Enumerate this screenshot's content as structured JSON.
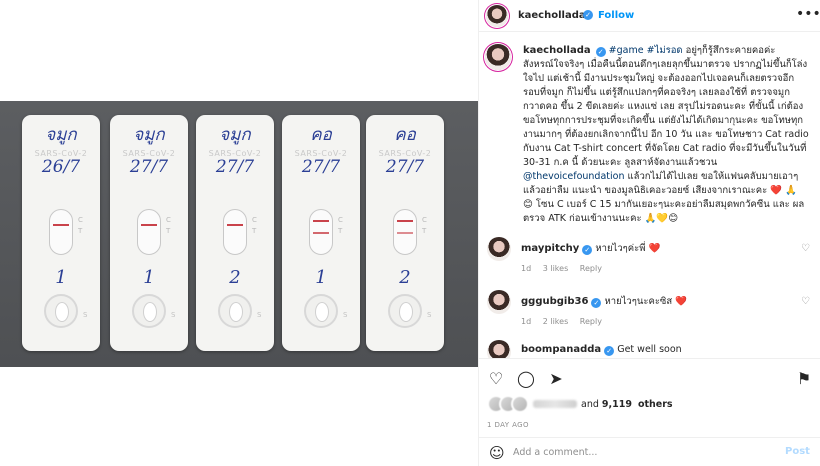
{
  "post": {
    "username": "kaechollada",
    "follow_label": "Follow",
    "more_icon": "more-horizontal-icon"
  },
  "caption": {
    "username": "kaechollada",
    "hashtags": [
      "#game",
      "#ไม่รอด"
    ],
    "text_part1": "อยู่ๆก็รู้สึกระคายคอค่ะ สังหรณ์ใจจริงๆ เมื่อคืนนี้ตอนดึกๆเลยลุกขึ้นมาตรวจ ปรากฏไม่ขึ้นก็โล่งใจไป แต่เช้านี้ มีงานประชุมใหญ่ จะต้องออกไปเจอคนก็เลยตรวจอีกรอบที่จมูก ก็ไม่ขึ้น แต่รู้สึกแปลกๆที่คอจริงๆ เลยลองใช้ที่ ตรวจจมูกกวาดคอ ขึ้น 2 ขีดเลยค่ะ แหงแซ่ เลย สรุปไม่รอดนะคะ ที่ขั้นนี้ เก่ต้องขอโทษทุกการประชุมที่จะเกิดขึ้น แต่ยังไม่ได้เกิดมากุนะคะ ขอโทษทุกงานมากๆ ที่ต้องยกเลิกจากนี้ไป อีก 10 วัน และ ขอโทษชาว Cat radio กับงาน Cat T-shirt concert ที่จัดโดย Cat radio ที่จะมีวันขึ้นในวันที่ 30-31 ก.ค นี้ ด้วยนะคะ ลูลสาห์จัดงานแล้วชวน",
    "mention": "@thevoicefoundation",
    "text_part2": "แล้วกไม่ได้ไปเลย ขอให้แฟนคลับมายเอาๆ แล้วอย่าลืม แนะนำ ของมูลนิธิเคอะวอยซ์ เสียงจากเราณะคะ ❤️ 🙏 😊 โซน C เบอร์ C 15 มากันเยอะๆนะคะอย่าลืมสมุดพกวัคซีน และ ผลตรวจ ATK ก่อนเข้างานนะคะ 🙏💛😊"
  },
  "comments": [
    {
      "username": "maypitchy",
      "text": "หายไวๆค่ะพี่",
      "emoji": "❤️",
      "age": "1d",
      "likes": "3 likes",
      "reply": "Reply"
    },
    {
      "username": "gggubgib36",
      "text": "หายไวๆนะคะซิส",
      "emoji": "❤️",
      "age": "1d",
      "likes": "2 likes",
      "reply": "Reply"
    },
    {
      "username": "boompanadda",
      "text": "Get well soon",
      "emoji": "",
      "age": "",
      "likes": "",
      "reply": ""
    }
  ],
  "likes": {
    "and_label": "and",
    "count": "9,119",
    "others_label": "others"
  },
  "date_label": "1 DAY AGO",
  "add_comment": {
    "placeholder": "Add a comment...",
    "post_label": "Post",
    "emoji_icon": "emoji-smile-icon"
  },
  "photo": {
    "tests": [
      {
        "location": "จมูก",
        "date": "26/7",
        "number": "1"
      },
      {
        "location": "จมูก",
        "date": "27/7",
        "number": "1"
      },
      {
        "location": "จมูก",
        "date": "27/7",
        "number": "2"
      },
      {
        "location": "คอ",
        "date": "27/7",
        "number": "1"
      },
      {
        "location": "คอ",
        "date": "27/7",
        "number": "2"
      }
    ],
    "brand": "SARS-CoV-2",
    "c_label": "C",
    "t_label": "T",
    "s_label": "S"
  },
  "colors": {
    "accent": "#0095f6",
    "verified": "#3897f0",
    "test_line": "#c9434b",
    "ink": "#2b3f95"
  }
}
